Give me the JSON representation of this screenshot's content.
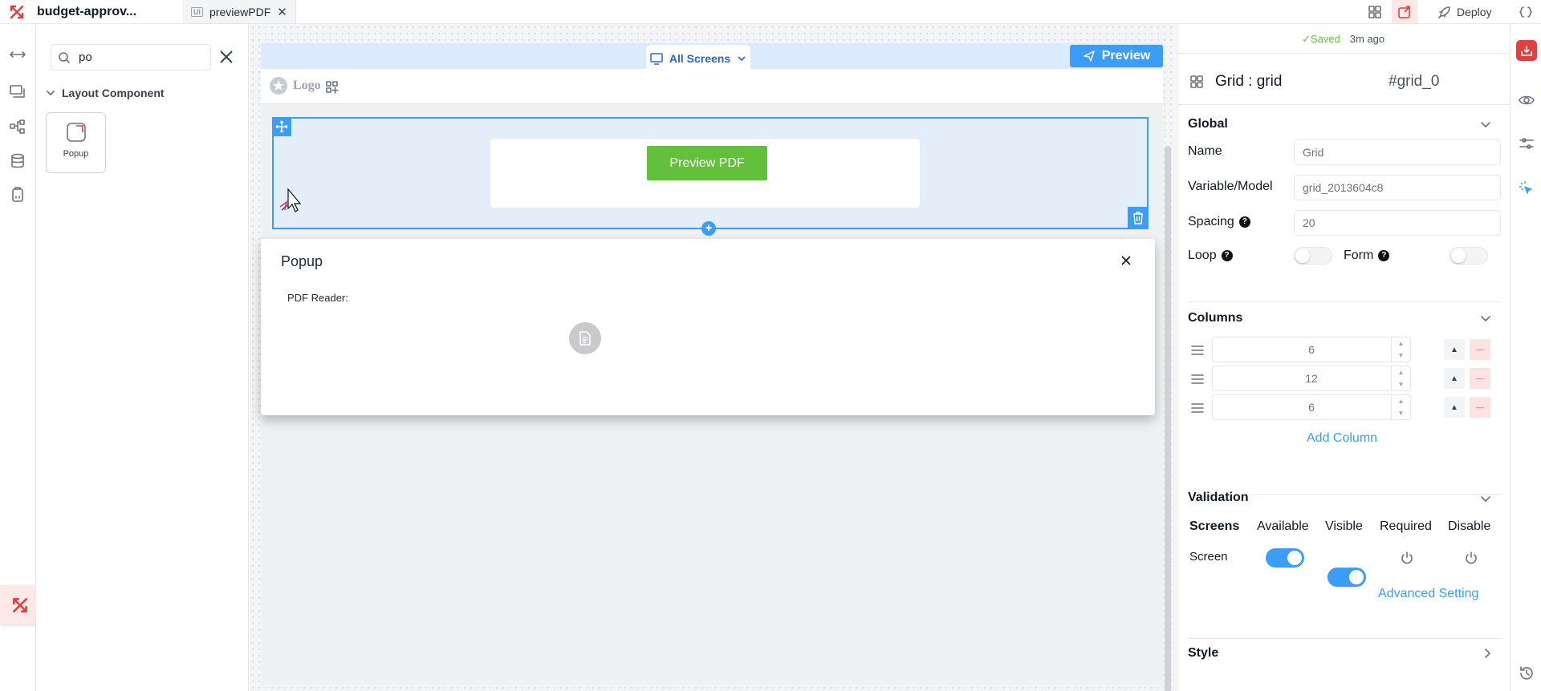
{
  "topbar": {
    "project_name": "budget-approv...",
    "tab_badge": "UI",
    "tab_label": "previewPDF",
    "deploy_label": "Deploy"
  },
  "components": {
    "search_value": "po",
    "category": "Layout Component",
    "items": [
      {
        "label": "Popup"
      }
    ]
  },
  "canvas": {
    "screens_label": "All Screens",
    "preview_label": "Preview",
    "logo_text": "Logo",
    "button_label": "Preview PDF",
    "popup": {
      "title": "Popup",
      "field_label": "PDF Reader:"
    }
  },
  "props": {
    "saved_status": "Saved",
    "saved_time": "3m ago",
    "component_title": "Grid : grid",
    "component_id": "#grid_0",
    "global": {
      "title": "Global",
      "name_label": "Name",
      "name_value": "Grid",
      "variable_label": "Variable/Model",
      "variable_value": "grid_2013604c8",
      "spacing_label": "Spacing",
      "spacing_value": "20",
      "loop_label": "Loop",
      "form_label": "Form"
    },
    "columns": {
      "title": "Columns",
      "items": [
        "6",
        "12",
        "6"
      ],
      "add_label": "Add Column"
    },
    "validation": {
      "title": "Validation",
      "headers": [
        "Screens",
        "Available",
        "Visible",
        "Required",
        "Disable"
      ],
      "row_label": "Screen",
      "advanced_label": "Advanced Setting"
    },
    "style_title": "Style"
  },
  "colors": {
    "accent": "#3b9df8",
    "green": "#62c03c",
    "brand_red": "#e53e3e"
  }
}
